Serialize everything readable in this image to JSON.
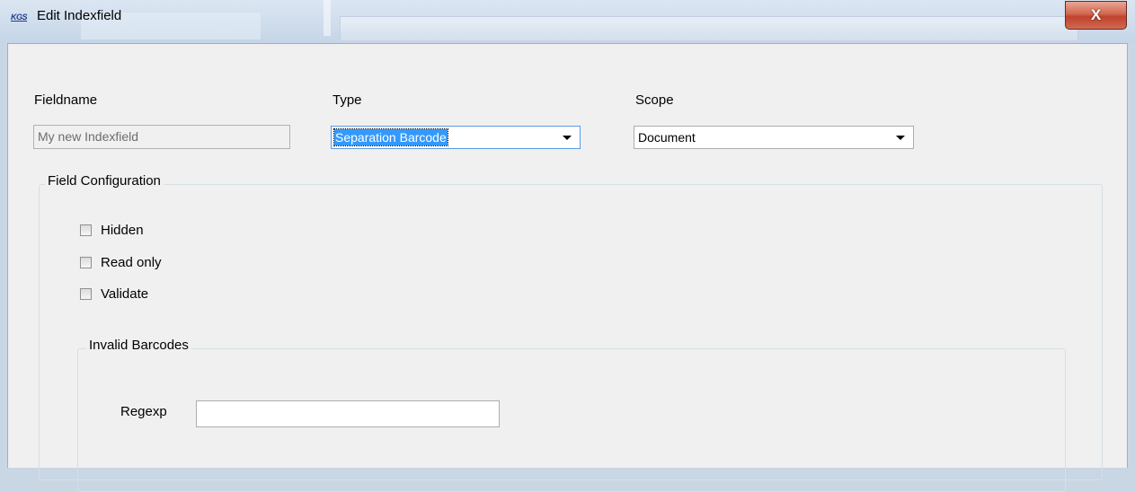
{
  "window": {
    "app_icon_text": "KGS",
    "title": "Edit Indexfield",
    "close_symbol": "X"
  },
  "form": {
    "fieldname": {
      "label": "Fieldname",
      "value": "My new Indexfield",
      "enabled": false
    },
    "type": {
      "label": "Type",
      "value": "Separation Barcode",
      "selected": true
    },
    "scope": {
      "label": "Scope",
      "value": "Document"
    }
  },
  "field_configuration": {
    "title": "Field Configuration",
    "checkboxes": [
      {
        "label": "Hidden",
        "checked": false
      },
      {
        "label": "Read only",
        "checked": false
      },
      {
        "label": "Validate",
        "checked": false
      }
    ]
  },
  "invalid_barcodes": {
    "title": "Invalid Barcodes",
    "regexp_label": "Regexp",
    "regexp_value": ""
  },
  "colors": {
    "selection": "#3399ff",
    "close_button": "#c0422c",
    "dialog_background": "#f0f0f0"
  }
}
